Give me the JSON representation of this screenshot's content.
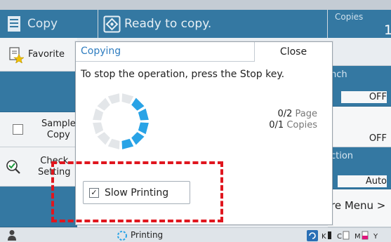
{
  "app": {
    "title": "Copy",
    "icon": "copy-document-icon"
  },
  "status": {
    "text": "Ready to copy.",
    "icon": "copy-start-diamond-icon"
  },
  "copies": {
    "label": "Copies",
    "value": "1"
  },
  "left_panel": {
    "favorites_label": "Favorite",
    "sample_copy_label_line1": "Sample",
    "sample_copy_label_line2": "Copy",
    "check_settings_line1": "Check",
    "check_settings_line2": "Setting"
  },
  "right_panel": {
    "item1_title": "nch",
    "item1_value": "OFF",
    "item2_value": "OFF",
    "item3_title": "ction",
    "item3_value": "Auto",
    "more_menu": "re Menu  >"
  },
  "dialog": {
    "title": "Copying",
    "close_label": "Close",
    "message": "To stop the operation, press the Stop key.",
    "page_progress": "0/2",
    "page_unit": "Page",
    "copies_progress": "0/1",
    "copies_unit": "Copies",
    "slow_printing_label": "Slow Printing",
    "slow_printing_checked": true
  },
  "bottom_bar": {
    "status": "Printing"
  },
  "colors": {
    "accent": "#3478a2",
    "spinner_active": "#29a3e6",
    "spinner_inactive": "#e3e6e9",
    "highlight": "#e0161e"
  }
}
